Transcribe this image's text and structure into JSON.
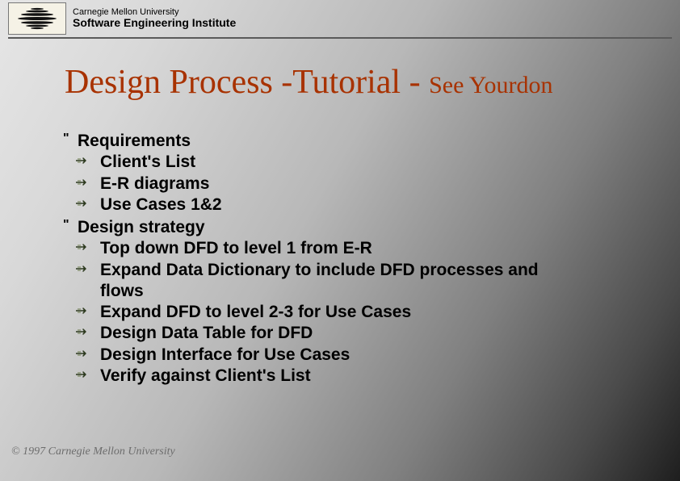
{
  "header": {
    "university": "Carnegie Mellon University",
    "institute": "Software Engineering Institute"
  },
  "title": {
    "main": "Design Process -Tutorial - ",
    "sub": "See Yourdon"
  },
  "body": [
    {
      "label": "Requirements",
      "items": [
        "Client's List",
        "E-R diagrams",
        "Use Cases 1&2"
      ]
    },
    {
      "label": "Design strategy",
      "items": [
        "Top down DFD to level 1 from E-R",
        "Expand Data Dictionary to include DFD processes and flows",
        "Expand DFD to level 2-3 for Use Cases",
        "Design Data Table for DFD",
        "Design Interface for Use Cases",
        "Verify against Client's List"
      ]
    }
  ],
  "footer": {
    "copyright": "© 1997 Carnegie Mellon University"
  }
}
